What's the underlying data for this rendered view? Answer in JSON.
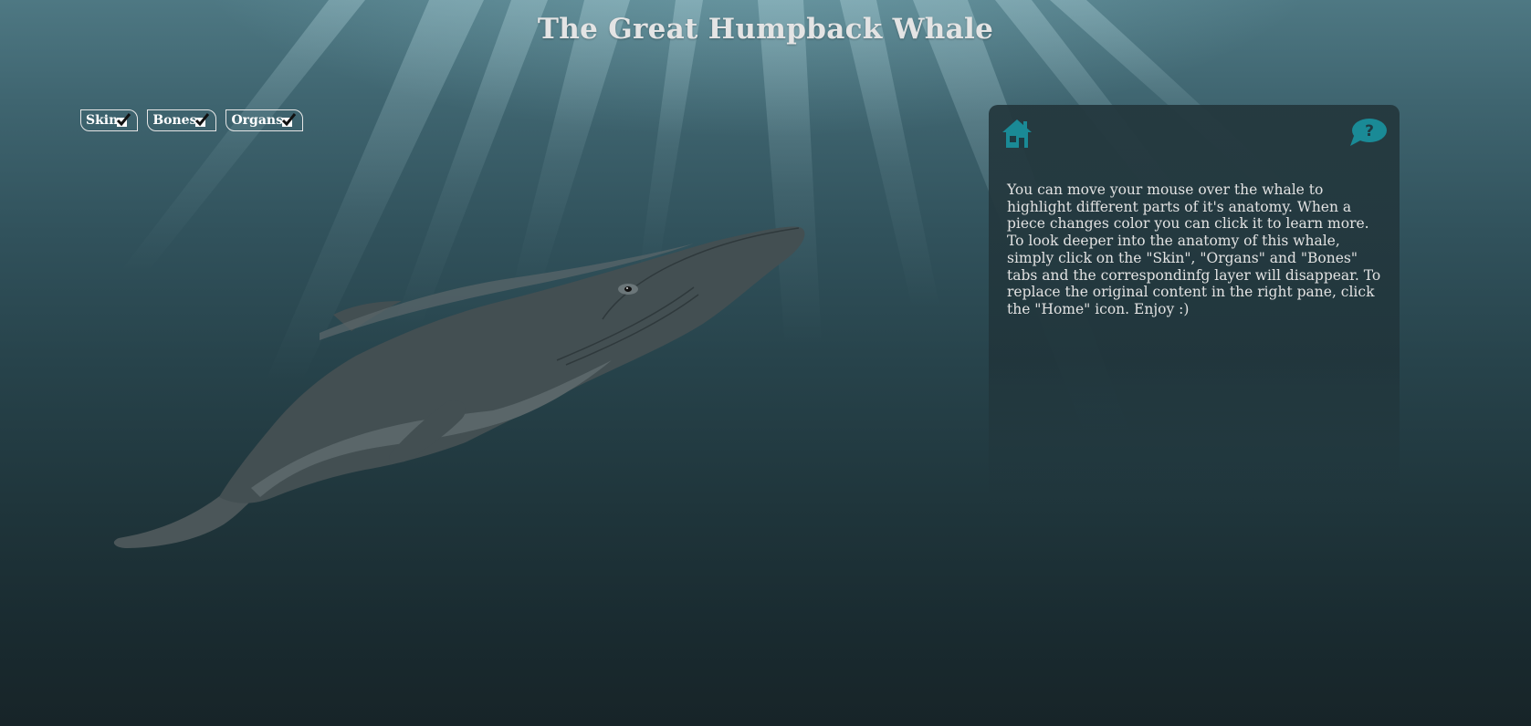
{
  "page": {
    "title": "The Great Humpback Whale"
  },
  "layers": {
    "tabs": [
      {
        "label": "Skin",
        "checked": true
      },
      {
        "label": "Bones",
        "checked": true
      },
      {
        "label": "Organs",
        "checked": true
      }
    ]
  },
  "info_panel": {
    "home_icon": "home-icon",
    "help_icon": "help-speech-bubble-icon",
    "help_glyph": "?",
    "text": "You can move your mouse over the whale to highlight different parts of it's anatomy. When a piece changes color you can click it to learn more. To look deeper into the anatomy of this whale, simply click on the \"Skin\", \"Organs\" and \"Bones\" tabs and the correspondinfg layer will disappear. To replace the original content in the right pane, click the \"Home\" icon. Enjoy :)"
  },
  "colors": {
    "accent_teal": "#1a8a96",
    "whale_body": "#434f52",
    "whale_belly": "#5a6669",
    "text_light": "#e2e2e2"
  }
}
